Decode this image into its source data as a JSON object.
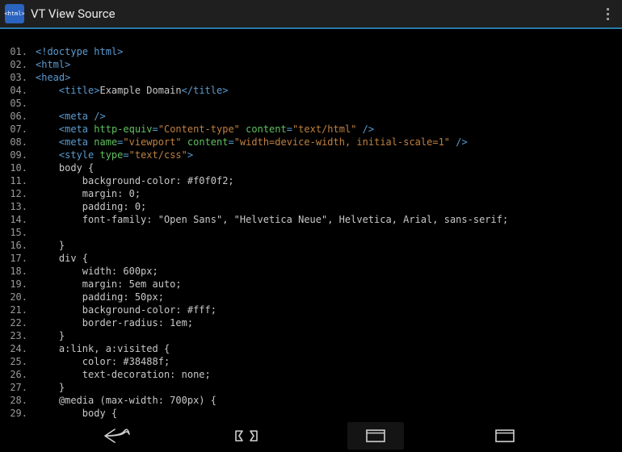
{
  "app": {
    "icon_text": "<html>",
    "title": "VT View Source"
  },
  "gutter_sep": ".",
  "source": {
    "lines": [
      {
        "n": "01",
        "seg": [
          [
            "tag",
            "<!doctype html>"
          ]
        ]
      },
      {
        "n": "02",
        "seg": [
          [
            "tag",
            "<html>"
          ]
        ]
      },
      {
        "n": "03",
        "seg": [
          [
            "tag",
            "<head>"
          ]
        ]
      },
      {
        "n": "04",
        "seg": [
          [
            "plain",
            "    "
          ],
          [
            "tag",
            "<title>"
          ],
          [
            "plain",
            "Example Domain"
          ],
          [
            "tag",
            "</title>"
          ]
        ]
      },
      {
        "n": "05",
        "seg": []
      },
      {
        "n": "06",
        "seg": [
          [
            "plain",
            "    "
          ],
          [
            "tag",
            "<meta />"
          ]
        ]
      },
      {
        "n": "07",
        "seg": [
          [
            "plain",
            "    "
          ],
          [
            "tag",
            "<meta "
          ],
          [
            "attr",
            "http-equiv"
          ],
          [
            "tag",
            "="
          ],
          [
            "str",
            "\"Content-type\""
          ],
          [
            "tag",
            " "
          ],
          [
            "attr",
            "content"
          ],
          [
            "tag",
            "="
          ],
          [
            "str",
            "\"text/html\""
          ],
          [
            "tag",
            " />"
          ]
        ]
      },
      {
        "n": "08",
        "seg": [
          [
            "plain",
            "    "
          ],
          [
            "tag",
            "<meta "
          ],
          [
            "attr",
            "name"
          ],
          [
            "tag",
            "="
          ],
          [
            "str",
            "\"viewport\""
          ],
          [
            "tag",
            " "
          ],
          [
            "attr",
            "content"
          ],
          [
            "tag",
            "="
          ],
          [
            "str",
            "\"width=device-width, initial-scale=1\""
          ],
          [
            "tag",
            " />"
          ]
        ]
      },
      {
        "n": "09",
        "seg": [
          [
            "plain",
            "    "
          ],
          [
            "tag",
            "<style "
          ],
          [
            "attr",
            "type"
          ],
          [
            "tag",
            "="
          ],
          [
            "str",
            "\"text/css\""
          ],
          [
            "tag",
            ">"
          ]
        ]
      },
      {
        "n": "10",
        "seg": [
          [
            "plain",
            "    body {"
          ]
        ]
      },
      {
        "n": "11",
        "seg": [
          [
            "plain",
            "        background-color: #f0f0f2;"
          ]
        ]
      },
      {
        "n": "12",
        "seg": [
          [
            "plain",
            "        margin: 0;"
          ]
        ]
      },
      {
        "n": "13",
        "seg": [
          [
            "plain",
            "        padding: 0;"
          ]
        ]
      },
      {
        "n": "14",
        "seg": [
          [
            "plain",
            "        font-family: \"Open Sans\", \"Helvetica Neue\", Helvetica, Arial, sans-serif;"
          ]
        ]
      },
      {
        "n": "15",
        "seg": []
      },
      {
        "n": "16",
        "seg": [
          [
            "plain",
            "    }"
          ]
        ]
      },
      {
        "n": "17",
        "seg": [
          [
            "plain",
            "    div {"
          ]
        ]
      },
      {
        "n": "18",
        "seg": [
          [
            "plain",
            "        width: 600px;"
          ]
        ]
      },
      {
        "n": "19",
        "seg": [
          [
            "plain",
            "        margin: 5em auto;"
          ]
        ]
      },
      {
        "n": "20",
        "seg": [
          [
            "plain",
            "        padding: 50px;"
          ]
        ]
      },
      {
        "n": "21",
        "seg": [
          [
            "plain",
            "        background-color: #fff;"
          ]
        ]
      },
      {
        "n": "22",
        "seg": [
          [
            "plain",
            "        border-radius: 1em;"
          ]
        ]
      },
      {
        "n": "23",
        "seg": [
          [
            "plain",
            "    }"
          ]
        ]
      },
      {
        "n": "24",
        "seg": [
          [
            "plain",
            "    a:link, a:visited {"
          ]
        ]
      },
      {
        "n": "25",
        "seg": [
          [
            "plain",
            "        color: #38488f;"
          ]
        ]
      },
      {
        "n": "26",
        "seg": [
          [
            "plain",
            "        text-decoration: none;"
          ]
        ]
      },
      {
        "n": "27",
        "seg": [
          [
            "plain",
            "    }"
          ]
        ]
      },
      {
        "n": "28",
        "seg": [
          [
            "plain",
            "    @media (max-width: 700px) {"
          ]
        ]
      },
      {
        "n": "29",
        "seg": [
          [
            "plain",
            "        body {"
          ]
        ]
      }
    ]
  }
}
